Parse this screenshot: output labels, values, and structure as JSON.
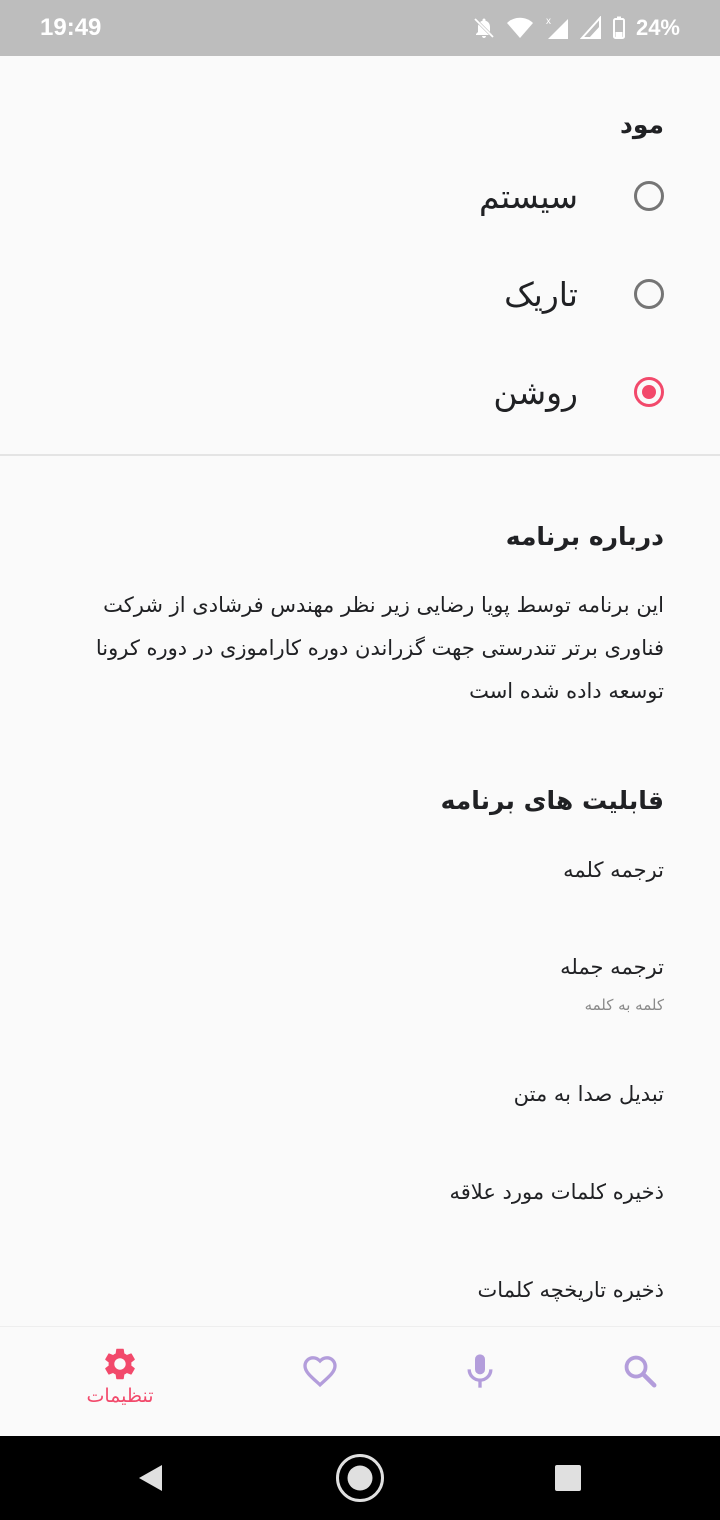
{
  "status_bar": {
    "time": "19:49",
    "battery": "24%",
    "icons": [
      "notifications-off-icon",
      "wifi-icon",
      "signal-x-icon",
      "signal-icon",
      "battery-icon"
    ]
  },
  "mode": {
    "title": "مود",
    "options": [
      {
        "label": "سیستم",
        "selected": false
      },
      {
        "label": "تاریک",
        "selected": false
      },
      {
        "label": "روشن",
        "selected": true
      }
    ]
  },
  "about": {
    "title": "درباره برنامه",
    "lines": [
      "این برنامه توسط پویا رضایی زیر نظر مهندس فرشادی از شرکت",
      "فناوری برتر تندرستی جهت گزراندن دوره کاراموزی در دوره کرونا",
      "توسعه داده شده است"
    ]
  },
  "features": {
    "title": "قابلیت های برنامه",
    "items": [
      {
        "label": "ترجمه کلمه"
      },
      {
        "label": "ترجمه جمله",
        "subtitle": "کلمه به کلمه"
      },
      {
        "label": "تبدیل صدا به متن"
      },
      {
        "label": "ذخیره کلمات مورد علاقه"
      },
      {
        "label": "ذخیره تاریخچه کلمات"
      }
    ]
  },
  "bottom_nav": {
    "items": [
      {
        "icon": "gear-icon",
        "label": "تنظیمات",
        "active": true
      },
      {
        "icon": "heart-icon",
        "label": "",
        "active": false
      },
      {
        "icon": "microphone-icon",
        "label": "",
        "active": false
      },
      {
        "icon": "search-icon",
        "label": "",
        "active": false
      }
    ],
    "active_color": "#f2496b",
    "inactive_color": "#b39ddb"
  },
  "colors": {
    "accent": "#f2496b",
    "status_bar": "#bdbdbd"
  }
}
